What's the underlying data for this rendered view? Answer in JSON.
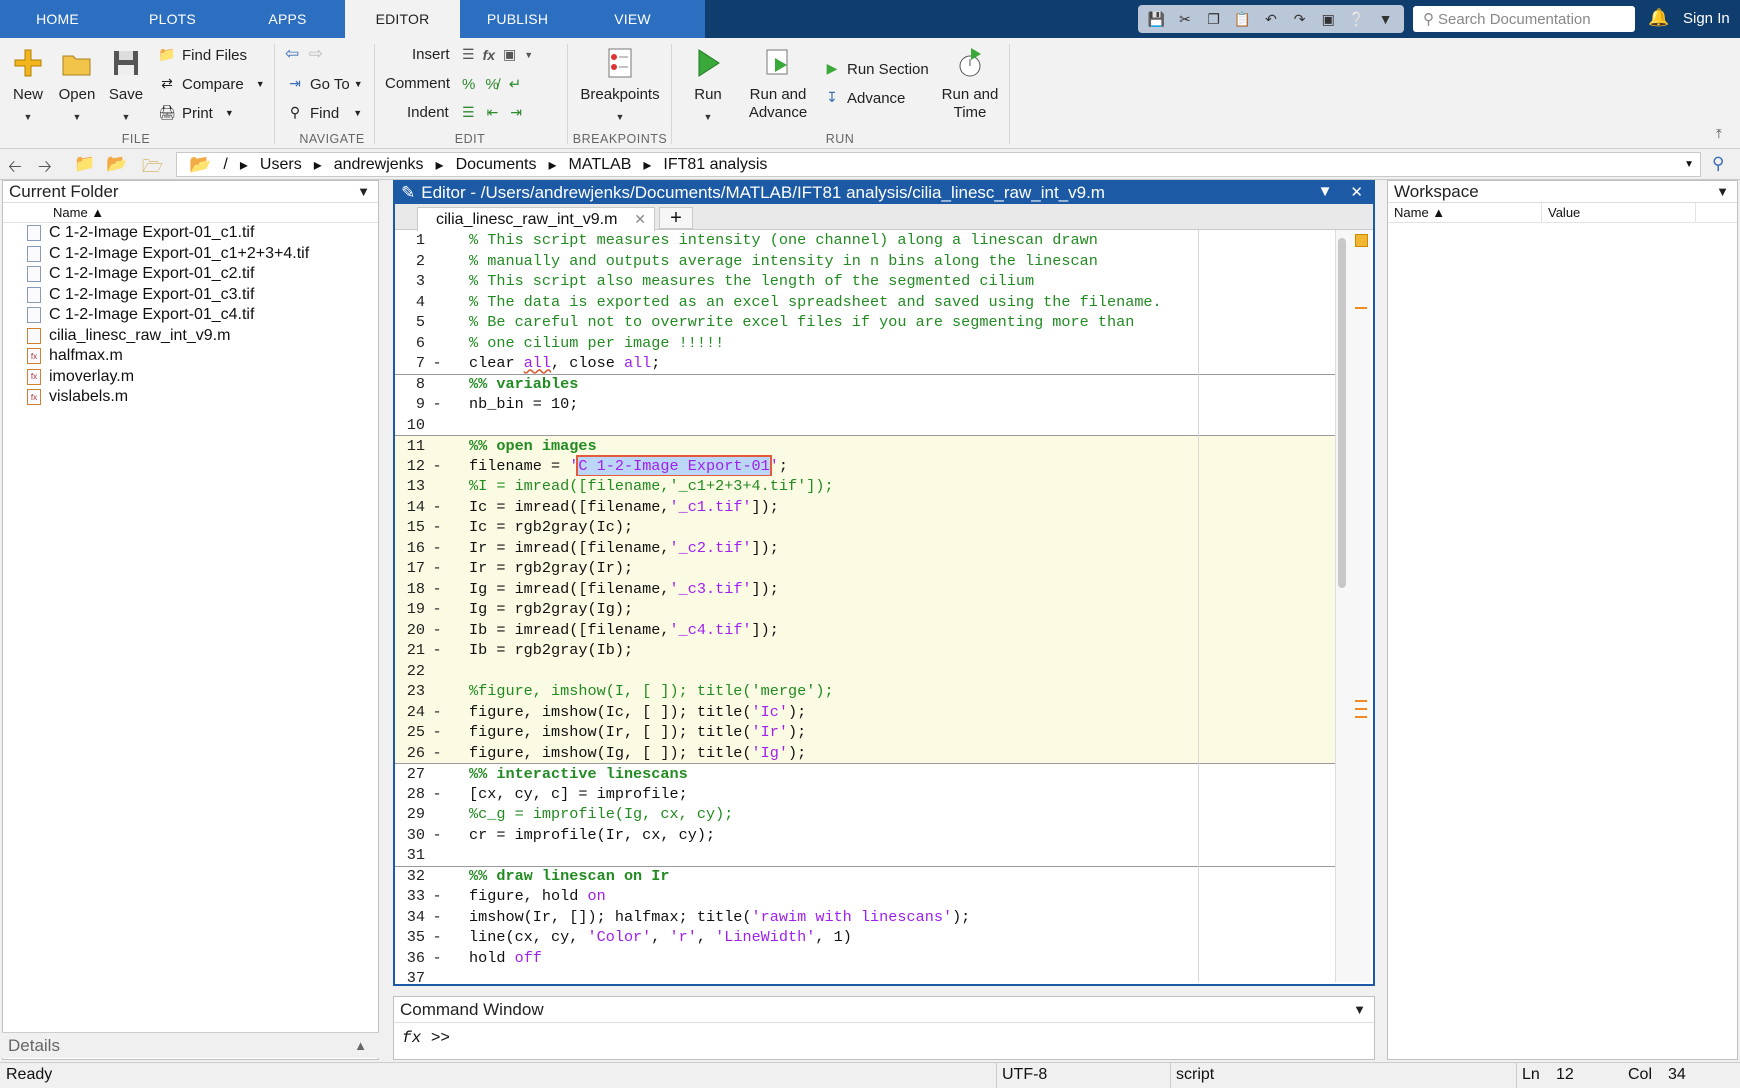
{
  "tabs": [
    "HOME",
    "PLOTS",
    "APPS",
    "EDITOR",
    "PUBLISH",
    "VIEW"
  ],
  "active_tab": "EDITOR",
  "search": {
    "placeholder": "Search Documentation"
  },
  "signin": "Sign In",
  "ribbon": {
    "file": {
      "new": "New",
      "open": "Open",
      "save": "Save",
      "find_files": "Find Files",
      "compare": "Compare",
      "print": "Print",
      "group": "FILE"
    },
    "navigate": {
      "go_to": "Go To",
      "find": "Find",
      "group": "NAVIGATE"
    },
    "edit": {
      "insert": "Insert",
      "comment": "Comment",
      "indent": "Indent",
      "group": "EDIT"
    },
    "breakpoints": {
      "label": "Breakpoints",
      "group": "BREAKPOINTS"
    },
    "run": {
      "run": "Run",
      "run_advance_1": "Run and",
      "run_advance_2": "Advance",
      "run_section": "Run Section",
      "advance": "Advance",
      "run_time_1": "Run and",
      "run_time_2": "Time",
      "group": "RUN"
    }
  },
  "path": [
    "/",
    "Users",
    "andrewjenks",
    "Documents",
    "MATLAB",
    "IFT81 analysis"
  ],
  "current_folder": {
    "title": "Current Folder",
    "col_name": "Name ▲",
    "files": [
      "C 1-2-Image Export-01_c1.tif",
      "C 1-2-Image Export-01_c1+2+3+4.tif",
      "C 1-2-Image Export-01_c2.tif",
      "C 1-2-Image Export-01_c3.tif",
      "C 1-2-Image Export-01_c4.tif",
      "cilia_linesc_raw_int_v9.m",
      "halfmax.m",
      "imoverlay.m",
      "vislabels.m"
    ],
    "details": "Details"
  },
  "editor": {
    "title": "Editor - /Users/andrewjenks/Documents/MATLAB/IFT81 analysis/cilia_linesc_raw_int_v9.m",
    "tab": "cilia_linesc_raw_int_v9.m",
    "lines": [
      {
        "n": "1",
        "d": "",
        "h": "<span class='c'>% This script measures intensity (one channel) along a linescan drawn</span>"
      },
      {
        "n": "2",
        "d": "",
        "h": "<span class='c'>% manually and outputs average intensity in n bins along the linescan</span>"
      },
      {
        "n": "3",
        "d": "",
        "h": "<span class='c'>% This script also measures the length of the segmented cilium</span>"
      },
      {
        "n": "4",
        "d": "",
        "h": "<span class='c'>% The data is exported as an excel spreadsheet and saved using the filename.</span>"
      },
      {
        "n": "5",
        "d": "",
        "h": "<span class='c'>% Be careful not to overwrite excel files if you are segmenting more than</span>"
      },
      {
        "n": "6",
        "d": "",
        "h": "<span class='c'>% one cilium per image !!!!!</span>"
      },
      {
        "n": "7",
        "d": "-",
        "h": "clear <span class='s uw'>all</span>, close <span class='s'>all</span>;"
      },
      {
        "n": "8",
        "d": "",
        "sep": true,
        "h": "<span class='sec'>%% variables</span>"
      },
      {
        "n": "9",
        "d": "-",
        "h": "nb_bin = 10;"
      },
      {
        "n": "10",
        "d": "",
        "h": ""
      },
      {
        "n": "11",
        "d": "",
        "sep": true,
        "cell": true,
        "h": "<span class='sec'>%% open images</span>"
      },
      {
        "n": "12",
        "d": "-",
        "cell": true,
        "h": "filename = <span class='s'>'</span><span class='s hl'>C 1-2-Image Export-01</span><span class='s'>'</span>;"
      },
      {
        "n": "13",
        "d": "",
        "cell": true,
        "h": "<span class='c'>%I = imread([filename,'_c1+2+3+4.tif']);</span>"
      },
      {
        "n": "14",
        "d": "-",
        "cell": true,
        "h": "Ic = imread([filename,<span class='s'>'_c1.tif'</span>]);"
      },
      {
        "n": "15",
        "d": "-",
        "cell": true,
        "h": "Ic = rgb2gray(Ic);"
      },
      {
        "n": "16",
        "d": "-",
        "cell": true,
        "h": "Ir = imread([filename,<span class='s'>'_c2.tif'</span>]);"
      },
      {
        "n": "17",
        "d": "-",
        "cell": true,
        "h": "Ir = rgb2gray(Ir);"
      },
      {
        "n": "18",
        "d": "-",
        "cell": true,
        "h": "Ig = imread([filename,<span class='s'>'_c3.tif'</span>]);"
      },
      {
        "n": "19",
        "d": "-",
        "cell": true,
        "h": "Ig = rgb2gray(Ig);"
      },
      {
        "n": "20",
        "d": "-",
        "cell": true,
        "h": "Ib = imread([filename,<span class='s'>'_c4.tif'</span>]);"
      },
      {
        "n": "21",
        "d": "-",
        "cell": true,
        "h": "Ib = rgb2gray(Ib);"
      },
      {
        "n": "22",
        "d": "",
        "cell": true,
        "h": ""
      },
      {
        "n": "23",
        "d": "",
        "cell": true,
        "h": "<span class='c'>%figure, imshow(I, [ ]); title('merge');</span>"
      },
      {
        "n": "24",
        "d": "-",
        "cell": true,
        "h": "figure, imshow(Ic, [ ]); title(<span class='s'>'Ic'</span>);"
      },
      {
        "n": "25",
        "d": "-",
        "cell": true,
        "h": "figure, imshow(Ir, [ ]); title(<span class='s'>'Ir'</span>);"
      },
      {
        "n": "26",
        "d": "-",
        "cell": true,
        "h": "figure, imshow(Ig, [ ]); title(<span class='s'>'Ig'</span>);"
      },
      {
        "n": "27",
        "d": "",
        "sep": true,
        "h": "<span class='sec'>%% interactive linescans</span>"
      },
      {
        "n": "28",
        "d": "-",
        "h": "[cx, cy, c] = improfile;"
      },
      {
        "n": "29",
        "d": "",
        "h": "<span class='c'>%c_g = improfile(Ig, cx, cy);</span>"
      },
      {
        "n": "30",
        "d": "-",
        "h": "cr = improfile(Ir, cx, cy);"
      },
      {
        "n": "31",
        "d": "",
        "h": ""
      },
      {
        "n": "32",
        "d": "",
        "sep": true,
        "h": "<span class='sec'>%% draw linescan on Ir</span>"
      },
      {
        "n": "33",
        "d": "-",
        "h": "figure, hold <span class='s'>on</span>"
      },
      {
        "n": "34",
        "d": "-",
        "h": "imshow(Ir, []); halfmax; title(<span class='s'>'rawim with linescans'</span>);"
      },
      {
        "n": "35",
        "d": "-",
        "h": "line(cx, cy, <span class='s'>'Color'</span>, <span class='s'>'r'</span>, <span class='s'>'LineWidth'</span>, 1)"
      },
      {
        "n": "36",
        "d": "-",
        "h": "hold <span class='s'>off</span>"
      },
      {
        "n": "37",
        "d": "",
        "h": ""
      }
    ]
  },
  "command_window": {
    "title": "Command Window",
    "prompt": ">>"
  },
  "workspace": {
    "title": "Workspace",
    "col_name": "Name ▲",
    "col_value": "Value"
  },
  "status": {
    "ready": "Ready",
    "encoding": "UTF-8",
    "type": "script",
    "ln_label": "Ln",
    "ln": "12",
    "col_label": "Col",
    "col": "34"
  }
}
